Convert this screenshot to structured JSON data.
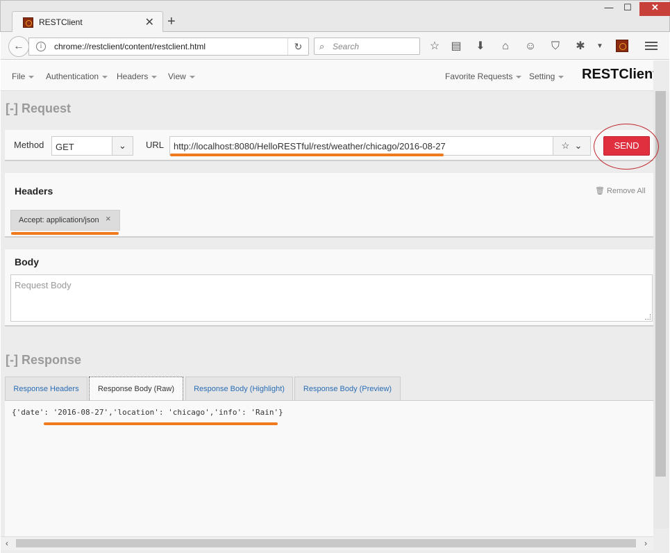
{
  "browser": {
    "tab_title": "RESTClient",
    "new_tab": "+",
    "address": "chrome://restclient/content/restclient.html",
    "search_placeholder": "Search",
    "window_min": "—",
    "window_max": "☐",
    "window_close": "✕"
  },
  "app_nav": {
    "file": "File",
    "authentication": "Authentication",
    "headers": "Headers",
    "view": "View",
    "favorite_requests": "Favorite Requests",
    "setting": "Setting",
    "brand": "RESTClient"
  },
  "request": {
    "section_title": "[-] Request",
    "method_label": "Method",
    "method_value": "GET",
    "url_label": "URL",
    "url_value": "http://localhost:8080/HelloRESTful/rest/weather/chicago/2016-08-27",
    "send_label": "SEND"
  },
  "headers_panel": {
    "title": "Headers",
    "remove_all": "Remove All",
    "items": [
      {
        "label": "Accept: application/json",
        "remove": "×"
      }
    ]
  },
  "body_panel": {
    "title": "Body",
    "placeholder": "Request Body"
  },
  "response": {
    "section_title": "[-] Response",
    "tabs": [
      {
        "label": "Response Headers"
      },
      {
        "label": "Response Body (Raw)"
      },
      {
        "label": "Response Body (Highlight)"
      },
      {
        "label": "Response Body (Preview)"
      }
    ],
    "active_tab": "Response Body (Raw)",
    "raw_body": "{'date': '2016-08-27','location': 'chicago','info': 'Rain'}"
  },
  "colors": {
    "send_button": "#e0303f",
    "annotation_underline": "#f07a1e",
    "annotation_circle": "#c0272d",
    "tab_link": "#2a6db5"
  }
}
